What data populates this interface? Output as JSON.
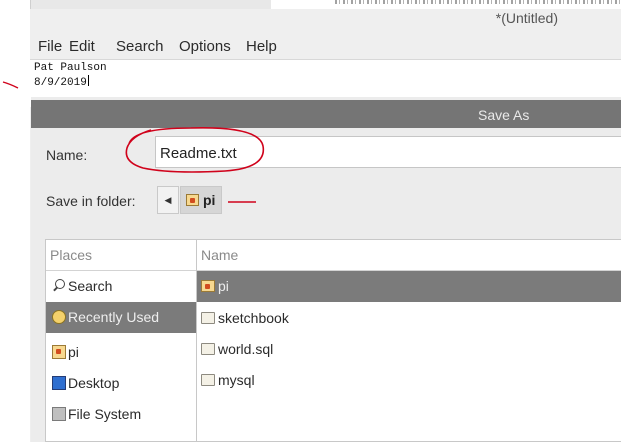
{
  "editor": {
    "title": "*(Untitled)",
    "menu": [
      "File",
      "Edit",
      "Search",
      "Options",
      "Help"
    ],
    "text_lines": [
      "Pat Paulson",
      "8/9/2019"
    ]
  },
  "dialog": {
    "title": "Save As",
    "name_label": "Name:",
    "name_value": "Readme.txt",
    "folder_label": "Save in folder:",
    "back_glyph": "◀",
    "current_folder": "pi",
    "places_header": "Places",
    "places": [
      {
        "label": "Search",
        "icon": "search-icon"
      },
      {
        "label": "Recently Used",
        "icon": "recent-icon",
        "selected": true
      },
      {
        "label": "pi",
        "icon": "home-folder-icon"
      },
      {
        "label": "Desktop",
        "icon": "desktop-icon"
      },
      {
        "label": "File System",
        "icon": "drive-icon"
      }
    ],
    "files_header": "Name",
    "files": [
      {
        "label": "pi",
        "icon": "home-folder-icon",
        "selected": true
      },
      {
        "label": "sketchbook",
        "icon": "folder-icon"
      },
      {
        "label": "world.sql",
        "icon": "folder-icon"
      },
      {
        "label": "mysql",
        "icon": "folder-icon"
      }
    ]
  },
  "annotation_color": "#d0021b"
}
